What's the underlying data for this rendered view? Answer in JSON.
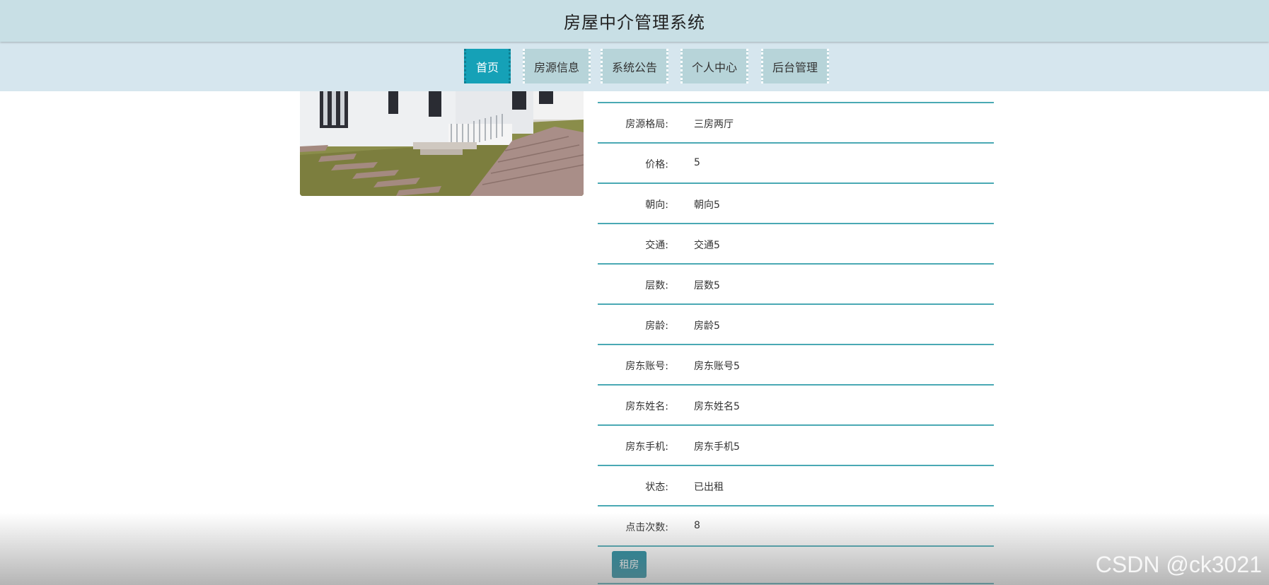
{
  "header": {
    "title": "房屋中介管理系统"
  },
  "nav": {
    "items": [
      {
        "label": "首页",
        "active": true
      },
      {
        "label": "房源信息",
        "active": false
      },
      {
        "label": "系统公告",
        "active": false
      },
      {
        "label": "个人中心",
        "active": false
      },
      {
        "label": "后台管理",
        "active": false
      }
    ]
  },
  "details": {
    "rows": [
      {
        "label": "房源格局:",
        "value": "三房两厅"
      },
      {
        "label": "价格:",
        "value": "5"
      },
      {
        "label": "朝向:",
        "value": "朝向5"
      },
      {
        "label": "交通:",
        "value": "交通5"
      },
      {
        "label": "层数:",
        "value": "层数5"
      },
      {
        "label": "房龄:",
        "value": "房龄5"
      },
      {
        "label": "房东账号:",
        "value": "房东账号5"
      },
      {
        "label": "房东姓名:",
        "value": "房东姓名5"
      },
      {
        "label": "房东手机:",
        "value": "房东手机5"
      },
      {
        "label": "状态:",
        "value": "已出租"
      },
      {
        "label": "点击次数:",
        "value": "8"
      }
    ],
    "rent_button_label": "租房"
  },
  "watermark": "CSDN @ck3021",
  "colors": {
    "title_bar_bg": "#c8dfe5",
    "nav_bg": "#d6e6ee",
    "nav_item_bg": "#b7d4d9",
    "nav_active_bg": "#15a1b7",
    "row_line": "#4aa9b4",
    "button_bg": "#17869b"
  }
}
